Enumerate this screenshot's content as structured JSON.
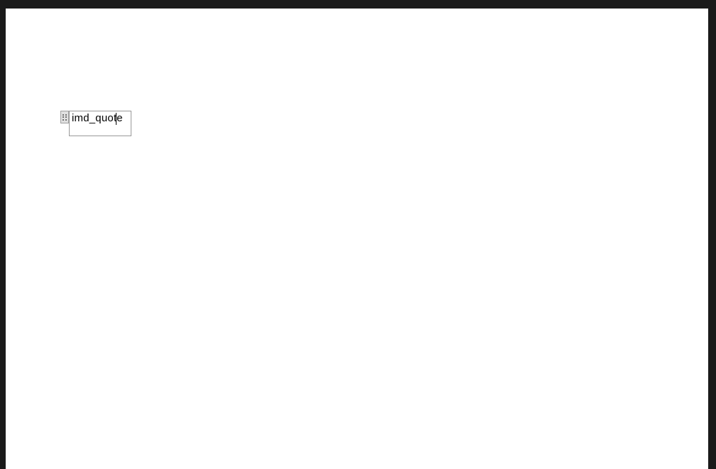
{
  "widget": {
    "label": "imd_quote"
  }
}
